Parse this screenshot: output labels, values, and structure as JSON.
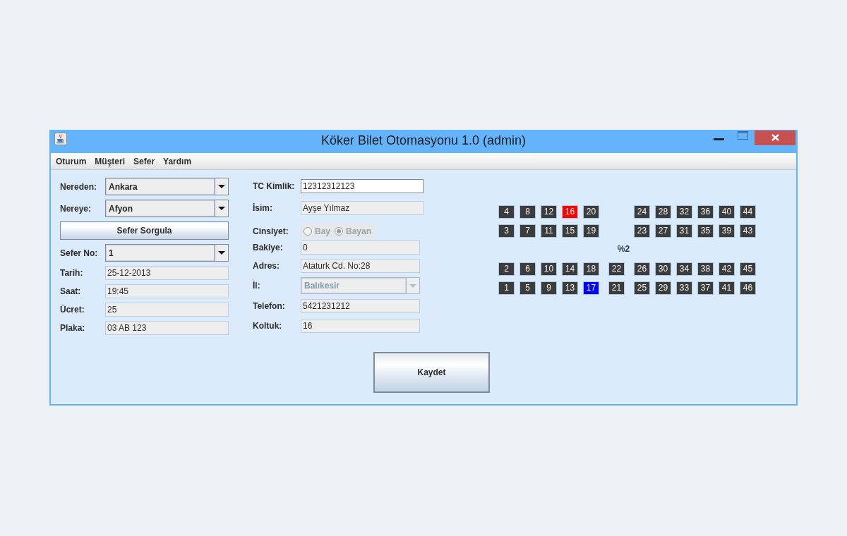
{
  "window": {
    "title": "Köker Bilet Otomasyonu 1.0 (admin)"
  },
  "menu": [
    "Oturum",
    "Müşteri",
    "Sefer",
    "Yardım"
  ],
  "trip_panel": {
    "items": [
      {
        "kind": "combo",
        "label": "Nereden:",
        "value": "Ankara",
        "disabled": false
      },
      {
        "kind": "combo",
        "label": "Nereye:",
        "value": "Afyon",
        "disabled": false
      },
      {
        "kind": "button",
        "label": "Sefer Sorgula"
      },
      {
        "kind": "combo",
        "label": "Sefer No:",
        "value": "1",
        "disabled": false
      },
      {
        "kind": "field",
        "label": "Tarih:",
        "value": "25-12-2013",
        "editable": false
      },
      {
        "kind": "field",
        "label": "Saat:",
        "value": "19:45",
        "editable": false
      },
      {
        "kind": "field",
        "label": "Ücret:",
        "value": "25",
        "editable": false
      },
      {
        "kind": "field",
        "label": "Plaka:",
        "value": "03 AB 123",
        "editable": false
      }
    ]
  },
  "customer_panel": {
    "items": [
      {
        "kind": "field",
        "label": "TC Kimlik:",
        "value": "12312312123",
        "editable": true
      },
      {
        "kind": "field",
        "label": "İsim:",
        "value": "Ayşe Yılmaz",
        "editable": false
      },
      {
        "kind": "radio",
        "label": "Cinsiyet:",
        "disabled": true,
        "options": [
          {
            "label": "Bay",
            "selected": false
          },
          {
            "label": "Bayan",
            "selected": true
          }
        ]
      },
      {
        "kind": "field",
        "label": "Bakiye:",
        "value": "0",
        "editable": false
      },
      {
        "kind": "field",
        "label": "Adres:",
        "value": "Ataturk Cd. No:28",
        "editable": false
      },
      {
        "kind": "combo",
        "label": "İl:",
        "value": "Balıkesir",
        "disabled": true
      },
      {
        "kind": "field",
        "label": "Telefon:",
        "value": "5421231212",
        "editable": false
      },
      {
        "kind": "field",
        "label": "Koltuk:",
        "value": "16",
        "editable": false
      }
    ]
  },
  "seat_map": {
    "top_rows": [
      [
        {
          "number": "4",
          "color": "#3c3c3c"
        },
        {
          "number": "8",
          "color": "#3c3c3c"
        },
        {
          "number": "12",
          "color": "#3c3c3c"
        },
        {
          "number": "16",
          "color": "#ff0000"
        },
        {
          "number": "20",
          "color": "#3c3c3c"
        },
        {
          "number": "24",
          "color": "#3c3c3c"
        },
        {
          "number": "28",
          "color": "#3c3c3c"
        },
        {
          "number": "32",
          "color": "#3c3c3c"
        },
        {
          "number": "36",
          "color": "#3c3c3c"
        },
        {
          "number": "40",
          "color": "#3c3c3c"
        },
        {
          "number": "44",
          "color": "#3c3c3c"
        }
      ],
      [
        {
          "number": "3",
          "color": "#3c3c3c"
        },
        {
          "number": "7",
          "color": "#3c3c3c"
        },
        {
          "number": "11",
          "color": "#3c3c3c"
        },
        {
          "number": "15",
          "color": "#3c3c3c"
        },
        {
          "number": "19",
          "color": "#3c3c3c"
        },
        {
          "number": "23",
          "color": "#3c3c3c"
        },
        {
          "number": "27",
          "color": "#3c3c3c"
        },
        {
          "number": "31",
          "color": "#3c3c3c"
        },
        {
          "number": "35",
          "color": "#3c3c3c"
        },
        {
          "number": "39",
          "color": "#3c3c3c"
        },
        {
          "number": "43",
          "color": "#3c3c3c"
        }
      ]
    ],
    "label": "%2",
    "bottom_rows": [
      [
        {
          "number": "2",
          "color": "#3c3c3c"
        },
        {
          "number": "6",
          "color": "#3c3c3c"
        },
        {
          "number": "10",
          "color": "#3c3c3c"
        },
        {
          "number": "14",
          "color": "#3c3c3c"
        },
        {
          "number": "18",
          "color": "#3c3c3c"
        },
        {
          "number": "22",
          "color": "#3c3c3c"
        },
        {
          "number": "26",
          "color": "#3c3c3c"
        },
        {
          "number": "30",
          "color": "#3c3c3c"
        },
        {
          "number": "34",
          "color": "#3c3c3c"
        },
        {
          "number": "38",
          "color": "#3c3c3c"
        },
        {
          "number": "42",
          "color": "#3c3c3c"
        },
        {
          "number": "45",
          "color": "#3c3c3c"
        }
      ],
      [
        {
          "number": "1",
          "color": "#3c3c3c"
        },
        {
          "number": "5",
          "color": "#3c3c3c"
        },
        {
          "number": "9",
          "color": "#3c3c3c"
        },
        {
          "number": "13",
          "color": "#3c3c3c"
        },
        {
          "number": "17",
          "color": "#0000ff"
        },
        {
          "number": "21",
          "color": "#3c3c3c"
        },
        {
          "number": "25",
          "color": "#3c3c3c"
        },
        {
          "number": "29",
          "color": "#3c3c3c"
        },
        {
          "number": "33",
          "color": "#3c3c3c"
        },
        {
          "number": "37",
          "color": "#3c3c3c"
        },
        {
          "number": "41",
          "color": "#3c3c3c"
        },
        {
          "number": "46",
          "color": "#3c3c3c"
        }
      ]
    ]
  },
  "save_button": {
    "label": "Kaydet"
  }
}
